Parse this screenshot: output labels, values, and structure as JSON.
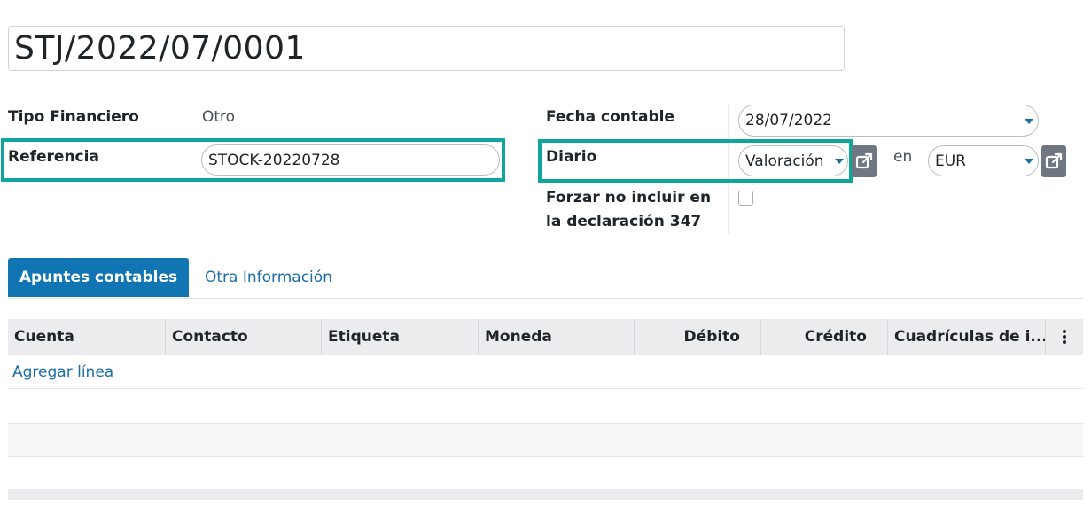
{
  "record": {
    "title": "STJ/2022/07/0001"
  },
  "left_fields": {
    "tipo_label": "Tipo Financiero",
    "tipo_value": "Otro",
    "referencia_label": "Referencia",
    "referencia_value": "STOCK-20220728"
  },
  "right_fields": {
    "fecha_label": "Fecha contable",
    "fecha_value": "28/07/2022",
    "diario_label": "Diario",
    "diario_value": "Valoración",
    "en_label": "en",
    "currency_value": "EUR",
    "forzar_label_line1": "Forzar no incluir en",
    "forzar_label_line2": "la declaración 347",
    "forzar_checked": false
  },
  "tabs": [
    {
      "label": "Apuntes contables",
      "active": true
    },
    {
      "label": "Otra Información",
      "active": false
    }
  ],
  "table": {
    "columns": [
      "Cuenta",
      "Contacto",
      "Etiqueta",
      "Moneda",
      "Débito",
      "Crédito",
      "Cuadrículas de i..."
    ],
    "add_line": "Agregar línea"
  },
  "colors": {
    "highlight": "#0fa59a",
    "primary": "#1175b3",
    "link": "#1a6ea8",
    "button_grey": "#6f7882"
  },
  "icons": {
    "external_link": "external-link-icon",
    "dropdown": "caret-down-icon",
    "column_options": "kebab-vertical-icon"
  }
}
